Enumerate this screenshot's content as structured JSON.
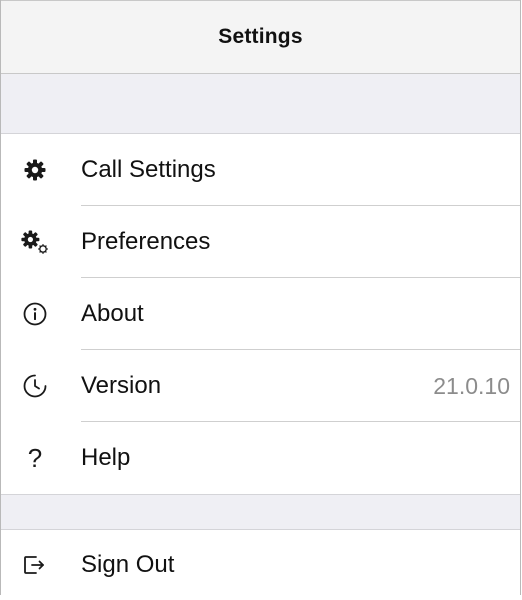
{
  "header": {
    "title": "Settings"
  },
  "menu": {
    "items": [
      {
        "label": "Call Settings",
        "icon": "gear-icon"
      },
      {
        "label": "Preferences",
        "icon": "gears-icon"
      },
      {
        "label": "About",
        "icon": "info-icon"
      },
      {
        "label": "Version",
        "icon": "clock-icon",
        "value": "21.0.10"
      },
      {
        "label": "Help",
        "icon": "question-icon",
        "glyph": "?"
      }
    ]
  },
  "account": {
    "items": [
      {
        "label": "Sign Out",
        "icon": "sign-out-icon"
      }
    ]
  },
  "colors": {
    "background": "#ffffff",
    "section_gap": "#efeff4",
    "navbar": "#f4f4f4",
    "divider": "#cfcfcf",
    "secondary_text": "#8c8c8c"
  }
}
